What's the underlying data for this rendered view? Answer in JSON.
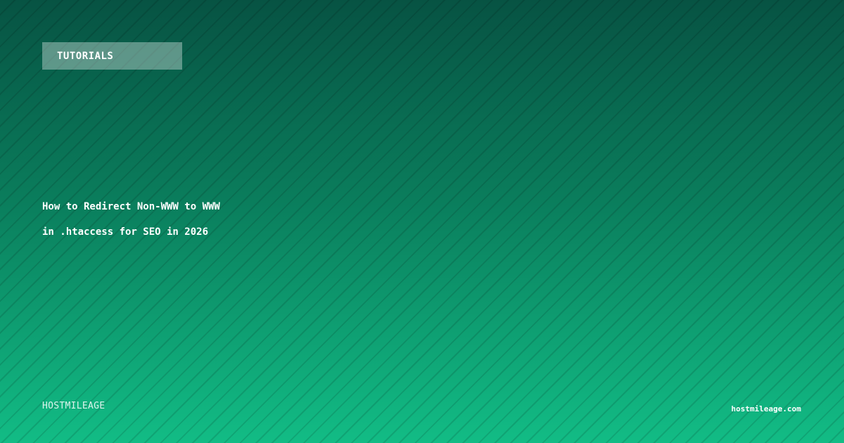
{
  "category": {
    "label": "TUTORIALS"
  },
  "title": {
    "line1": "How to Redirect Non-WWW to WWW",
    "line2": "in .htaccess for SEO in 2026"
  },
  "brand": {
    "name": "HOSTMILEAGE"
  },
  "site": {
    "url": "hostmileage.com"
  },
  "colors": {
    "gradient_top": "#075343",
    "gradient_bottom": "#12bc85",
    "text": "#ffffff"
  }
}
